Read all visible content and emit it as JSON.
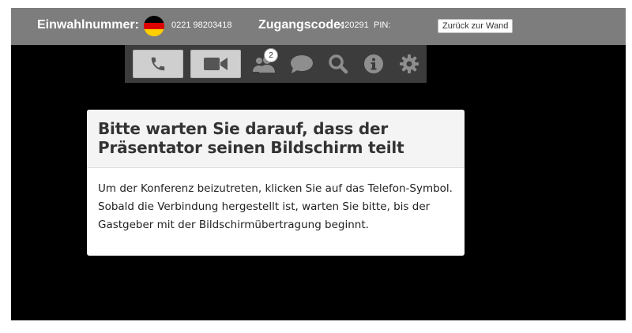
{
  "topbar": {
    "dial_in_label": "Einwahlnummer:",
    "country_flag": "germany-flag",
    "dial_in_number": "0221 98203418",
    "access_code_label": "Zugangscode:",
    "access_code": "420291",
    "pin_label": "PIN:",
    "back_button_label": "Zurück zur Wand"
  },
  "toolbar": {
    "items": [
      {
        "icon": "phone-icon",
        "active": true
      },
      {
        "icon": "video-camera-icon",
        "active": true
      },
      {
        "icon": "participants-icon",
        "active": false,
        "badge": "2"
      },
      {
        "icon": "chat-icon",
        "active": false
      },
      {
        "icon": "search-icon",
        "active": false
      },
      {
        "icon": "info-icon",
        "active": false
      },
      {
        "icon": "gear-icon",
        "active": false
      }
    ],
    "participants_badge": "2"
  },
  "dialog": {
    "title": "Bitte warten Sie darauf, dass der Präsentator seinen Bildschirm teilt",
    "body": "Um der Konferenz beizutreten, klicken Sie auf das Telefon-Symbol. Sobald die Verbindung hergestellt ist, warten Sie bitte, bis der Gastgeber mit der Bildschirmübertragung beginnt."
  },
  "colors": {
    "topbar": "#7d7d7d",
    "toolbar": "#3c3c3c",
    "stage": "#000000",
    "icon_inactive": "#8e8e8e",
    "icon_active": "#555555"
  }
}
